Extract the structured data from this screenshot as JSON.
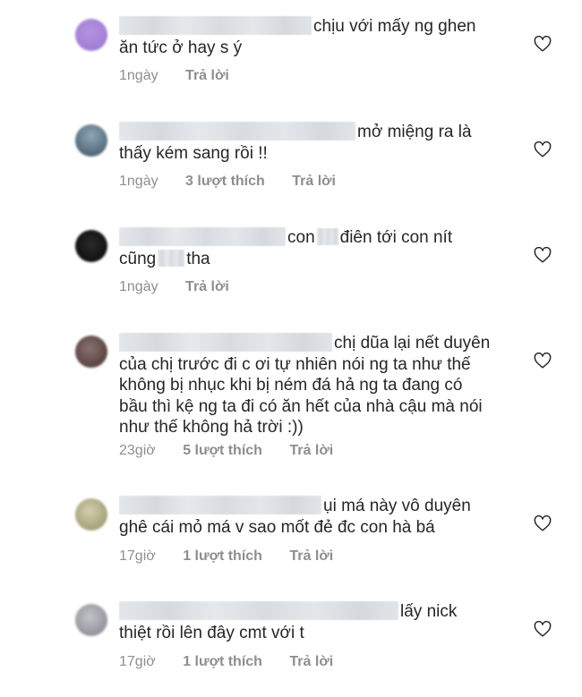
{
  "comments": [
    {
      "avatar_color": "#a77fd6",
      "line1": "chịu với mấy ng ghen",
      "line2": "ăn tức ở hay s ý",
      "time": "1ngày",
      "likes": "",
      "reply": "Trả lời"
    },
    {
      "avatar_color": "#5f7f96",
      "line1": "mở miệng ra là",
      "line2": "thấy kém sang rồi !!",
      "time": "1ngày",
      "likes": "3 lượt thích",
      "reply": "Trả lời"
    },
    {
      "avatar_color": "#1f1f1f",
      "line1_a": "con",
      "line1_b": "điên tới con nít",
      "line2_a": "cũng",
      "line2_b": "tha",
      "time": "1ngày",
      "likes": "",
      "reply": "Trả lời"
    },
    {
      "avatar_color": "#6a5350",
      "line1": "chị dũa lại nết duyên",
      "line2": "của chị trước đi c ơi tự nhiên nói ng ta như thế",
      "line3": "không bị nhục khi bị ném đá hả ng ta đang có",
      "line4": "bầu thì kệ ng ta đi có ăn hết của nhà cậu mà nói",
      "line5": "như thế không hả trời :))",
      "time": "23giờ",
      "likes": "5 lượt thích",
      "reply": "Trả lời"
    },
    {
      "avatar_color": "#b9b58f",
      "line1": "ụi má này vô duyên",
      "line2": "ghê cái mỏ má v sao mốt đẻ đc con hà bá",
      "time": "17giờ",
      "likes": "1 lượt thích",
      "reply": "Trả lời"
    },
    {
      "avatar_color": "#a9aab0",
      "line1": "lấy nick",
      "line2": "thiệt rồi lên đây cmt với t",
      "time": "17giờ",
      "likes": "1 lượt thích",
      "reply": "Trả lời"
    }
  ]
}
